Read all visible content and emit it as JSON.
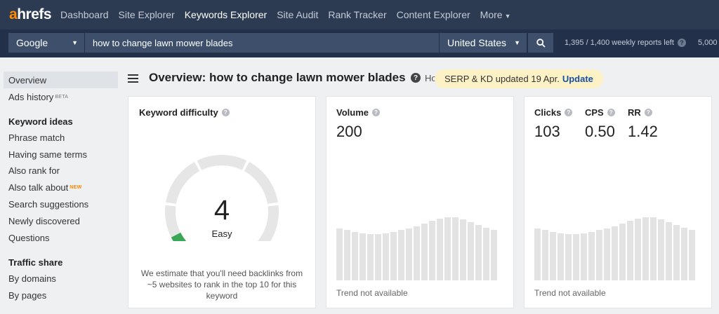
{
  "nav": {
    "logo_a": "a",
    "logo_rest": "hrefs",
    "items": [
      {
        "label": "Dashboard",
        "active": false
      },
      {
        "label": "Site Explorer",
        "active": false
      },
      {
        "label": "Keywords Explorer",
        "active": true
      },
      {
        "label": "Site Audit",
        "active": false
      },
      {
        "label": "Rank Tracker",
        "active": false
      },
      {
        "label": "Content Explorer",
        "active": false
      }
    ],
    "more_label": "More"
  },
  "search": {
    "engine": "Google",
    "keyword": "how to change lawn mower blades",
    "country": "United States",
    "reports_left": "1,395 / 1,400 weekly reports left",
    "reports_right": "5,000"
  },
  "sidebar": {
    "overview": "Overview",
    "ads_history": "Ads history",
    "ads_badge": "BETA",
    "keyword_ideas_heading": "Keyword ideas",
    "phrase_match": "Phrase match",
    "same_terms": "Having same terms",
    "also_rank_for": "Also rank for",
    "also_talk_about": "Also talk about",
    "new_badge": "NEW",
    "search_suggestions": "Search suggestions",
    "newly_discovered": "Newly discovered",
    "questions": "Questions",
    "traffic_share_heading": "Traffic share",
    "by_domains": "By domains",
    "by_pages": "By pages"
  },
  "header": {
    "title": "Overview: how to change lawn mower blades",
    "clipped_text": "Ho",
    "banner_text": "SERP & KD updated 19 Apr.",
    "banner_link": "Update"
  },
  "kd_card": {
    "label": "Keyword difficulty",
    "value": "4",
    "rating": "Easy",
    "note": "We estimate that you'll need backlinks from ~5 websites to rank in the top 10 for this keyword",
    "accent_color": "#3aa757",
    "gauge_fraction": 0.04
  },
  "volume_card": {
    "label": "Volume",
    "value": "200",
    "trend_note": "Trend not available",
    "bar_levels": [
      0.73,
      0.71,
      0.68,
      0.66,
      0.65,
      0.65,
      0.66,
      0.68,
      0.71,
      0.73,
      0.75,
      0.79,
      0.83,
      0.86,
      0.88,
      0.88,
      0.85,
      0.81,
      0.77,
      0.74,
      0.71
    ]
  },
  "clicks_card": {
    "clicks_label": "Clicks",
    "clicks_value": "103",
    "cps_label": "CPS",
    "cps_value": "0.50",
    "rr_label": "RR",
    "rr_value": "1.42",
    "trend_note": "Trend not available",
    "bar_levels": [
      0.73,
      0.71,
      0.68,
      0.66,
      0.65,
      0.65,
      0.66,
      0.68,
      0.71,
      0.73,
      0.75,
      0.79,
      0.83,
      0.86,
      0.88,
      0.88,
      0.85,
      0.81,
      0.77,
      0.74,
      0.71
    ]
  }
}
